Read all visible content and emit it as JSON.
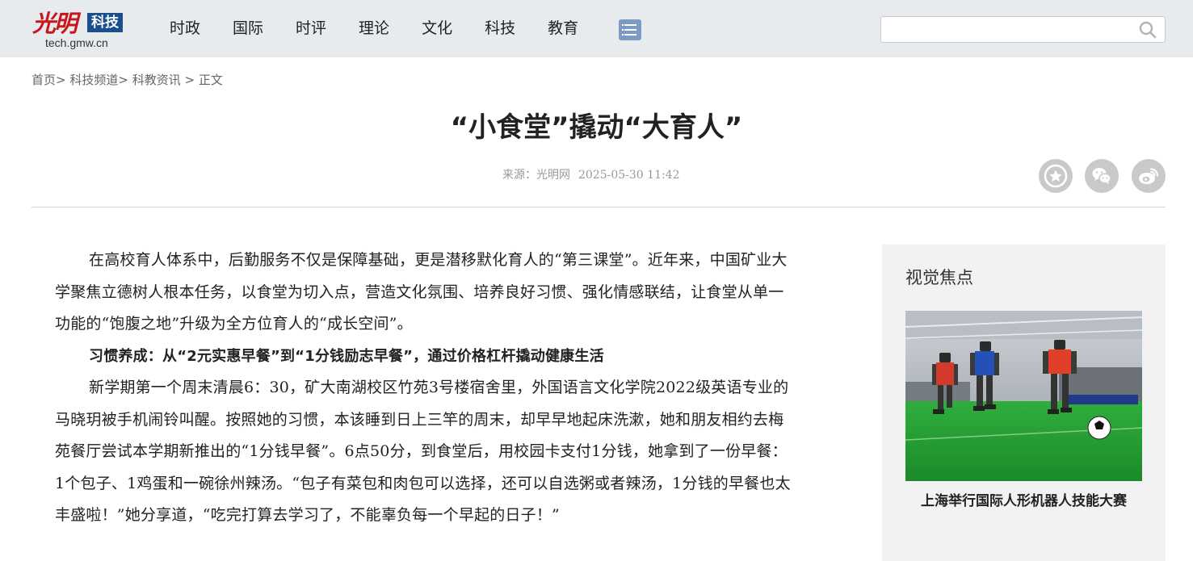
{
  "header": {
    "logo_script": "光明",
    "logo_badge": "科技",
    "logo_domain": "tech.gmw.cn",
    "nav": [
      "时政",
      "国际",
      "时评",
      "理论",
      "文化",
      "科技",
      "教育"
    ],
    "search_placeholder": ""
  },
  "breadcrumb": {
    "home": "首页",
    "sep1": "> ",
    "channel": "科技频道",
    "sep2": "> ",
    "section": "科教资讯",
    "sep3": " > ",
    "current": "正文"
  },
  "article": {
    "title": "“小食堂”撬动“大育人”",
    "source": "来源：光明网",
    "datetime": "2025-05-30 11:42",
    "paragraphs": [
      "在高校育人体系中，后勤服务不仅是保障基础，更是潜移默化育人的“第三课堂”。近年来，中国矿业大学聚焦立德树人根本任务，以食堂为切入点，营造文化氛围、培养良好习惯、强化情感联结，让食堂从单一功能的“饱腹之地”升级为全方位育人的“成长空间”。",
      "习惯养成：从“2元实惠早餐”到“1分钱励志早餐”，通过价格杠杆撬动健康生活",
      "新学期第一个周末清晨6：30，矿大南湖校区竹苑3号楼宿舍里，外国语言文化学院2022级英语专业的马晓玥被手机闹铃叫醒。按照她的习惯，本该睡到日上三竿的周末，却早早地起床洗漱，她和朋友相约去梅苑餐厅尝试本学期新推出的“1分钱早餐”。6点50分，到食堂后，用校园卡支付1分钱，她拿到了一份早餐：1个包子、1鸡蛋和一碗徐州辣汤。“包子有菜包和肉包可以选择，还可以自选粥或者辣汤，1分钱的早餐也太丰盛啦！”她分享道，“吃完打算去学习了，不能辜负每一个早起的日子！”"
    ]
  },
  "sidebar": {
    "title": "视觉焦点",
    "caption": "上海举行国际人形机器人技能大赛"
  },
  "colors": {
    "header_bg": "#e7ebee",
    "logo_red": "#c8161d",
    "logo_blue": "#1a4e8c",
    "menu_icon": "#7b9bc3",
    "share_grey": "#c9c9c9",
    "sidebar_bg": "#f2f2f2"
  },
  "icons": [
    "menu-icon",
    "search-icon",
    "favorite-star-icon",
    "wechat-icon",
    "weibo-icon"
  ]
}
